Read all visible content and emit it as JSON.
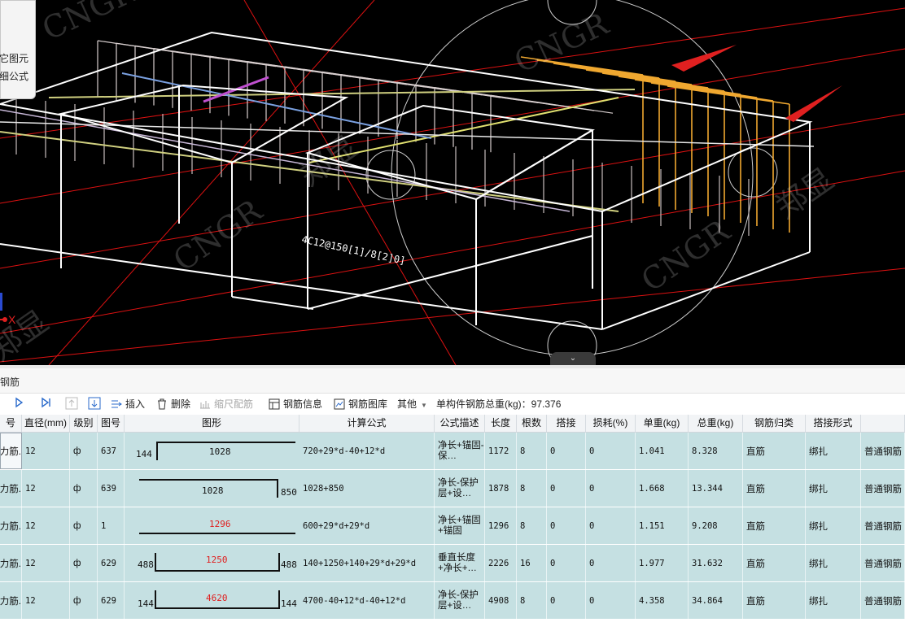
{
  "popup": {
    "line1": "它图元",
    "line2": "细公式"
  },
  "viewport": {
    "watermarks": [
      "CNGR",
      "CNGR",
      "CNGR",
      "CNGR",
      "郑显",
      "郑显",
      "郑显"
    ],
    "rebar_label": "4C12@150[1]/8[2]0]",
    "axis_label": "X"
  },
  "panel": {
    "title": "钢筋"
  },
  "toolbar": {
    "insert": "插入",
    "delete": "删除",
    "scale": "缩尺配筋",
    "info": "钢筋信息",
    "library": "钢筋图库",
    "other": "其他",
    "total_label": "单构件钢筋总重(kg)：97.376"
  },
  "columns": [
    "号",
    "直径(mm)",
    "级别",
    "图号",
    "图形",
    "计算公式",
    "公式描述",
    "长度",
    "根数",
    "搭接",
    "损耗(%)",
    "单重(kg)",
    "总重(kg)",
    "钢筋归类",
    "搭接形式",
    ""
  ],
  "rows": [
    {
      "name": "力筋.",
      "dia": "12",
      "grade": "ф",
      "fig": "637",
      "shape": {
        "left": "144",
        "mid": "1028",
        "right": ""
      },
      "formula": "720+29*d-40+12*d",
      "desc": "净长+锚固-保…",
      "len": "1172",
      "count": "8",
      "lap": "0",
      "loss": "0",
      "unit": "1.041",
      "total": "8.328",
      "cls": "直筋",
      "laptype": "绑扎",
      "type": "普通钢筋"
    },
    {
      "name": "力筋.",
      "dia": "12",
      "grade": "ф",
      "fig": "639",
      "shape": {
        "left": "",
        "mid": "1028",
        "right": "850"
      },
      "formula": "1028+850",
      "desc": "净长-保护层+设…",
      "len": "1878",
      "count": "8",
      "lap": "0",
      "loss": "0",
      "unit": "1.668",
      "total": "13.344",
      "cls": "直筋",
      "laptype": "绑扎",
      "type": "普通钢筋"
    },
    {
      "name": "力筋.",
      "dia": "12",
      "grade": "ф",
      "fig": "1",
      "shape": {
        "left": "",
        "mid": "1296",
        "right": ""
      },
      "formula": "600+29*d+29*d",
      "desc": "净长+锚固+锚固",
      "len": "1296",
      "count": "8",
      "lap": "0",
      "loss": "0",
      "unit": "1.151",
      "total": "9.208",
      "cls": "直筋",
      "laptype": "绑扎",
      "type": "普通钢筋"
    },
    {
      "name": "力筋.",
      "dia": "12",
      "grade": "ф",
      "fig": "629",
      "shape": {
        "left": "488",
        "mid": "1250",
        "right": "488"
      },
      "formula": "140+1250+140+29*d+29*d",
      "desc": "垂直长度+净长+…",
      "len": "2226",
      "count": "16",
      "lap": "0",
      "loss": "0",
      "unit": "1.977",
      "total": "31.632",
      "cls": "直筋",
      "laptype": "绑扎",
      "type": "普通钢筋"
    },
    {
      "name": "力筋.",
      "dia": "12",
      "grade": "ф",
      "fig": "629",
      "shape": {
        "left": "144",
        "mid": "4620",
        "right": "144"
      },
      "formula": "4700-40+12*d-40+12*d",
      "desc": "净长-保护层+设…",
      "len": "4908",
      "count": "8",
      "lap": "0",
      "loss": "0",
      "unit": "4.358",
      "total": "34.864",
      "cls": "直筋",
      "laptype": "绑扎",
      "type": "普通钢筋"
    }
  ]
}
